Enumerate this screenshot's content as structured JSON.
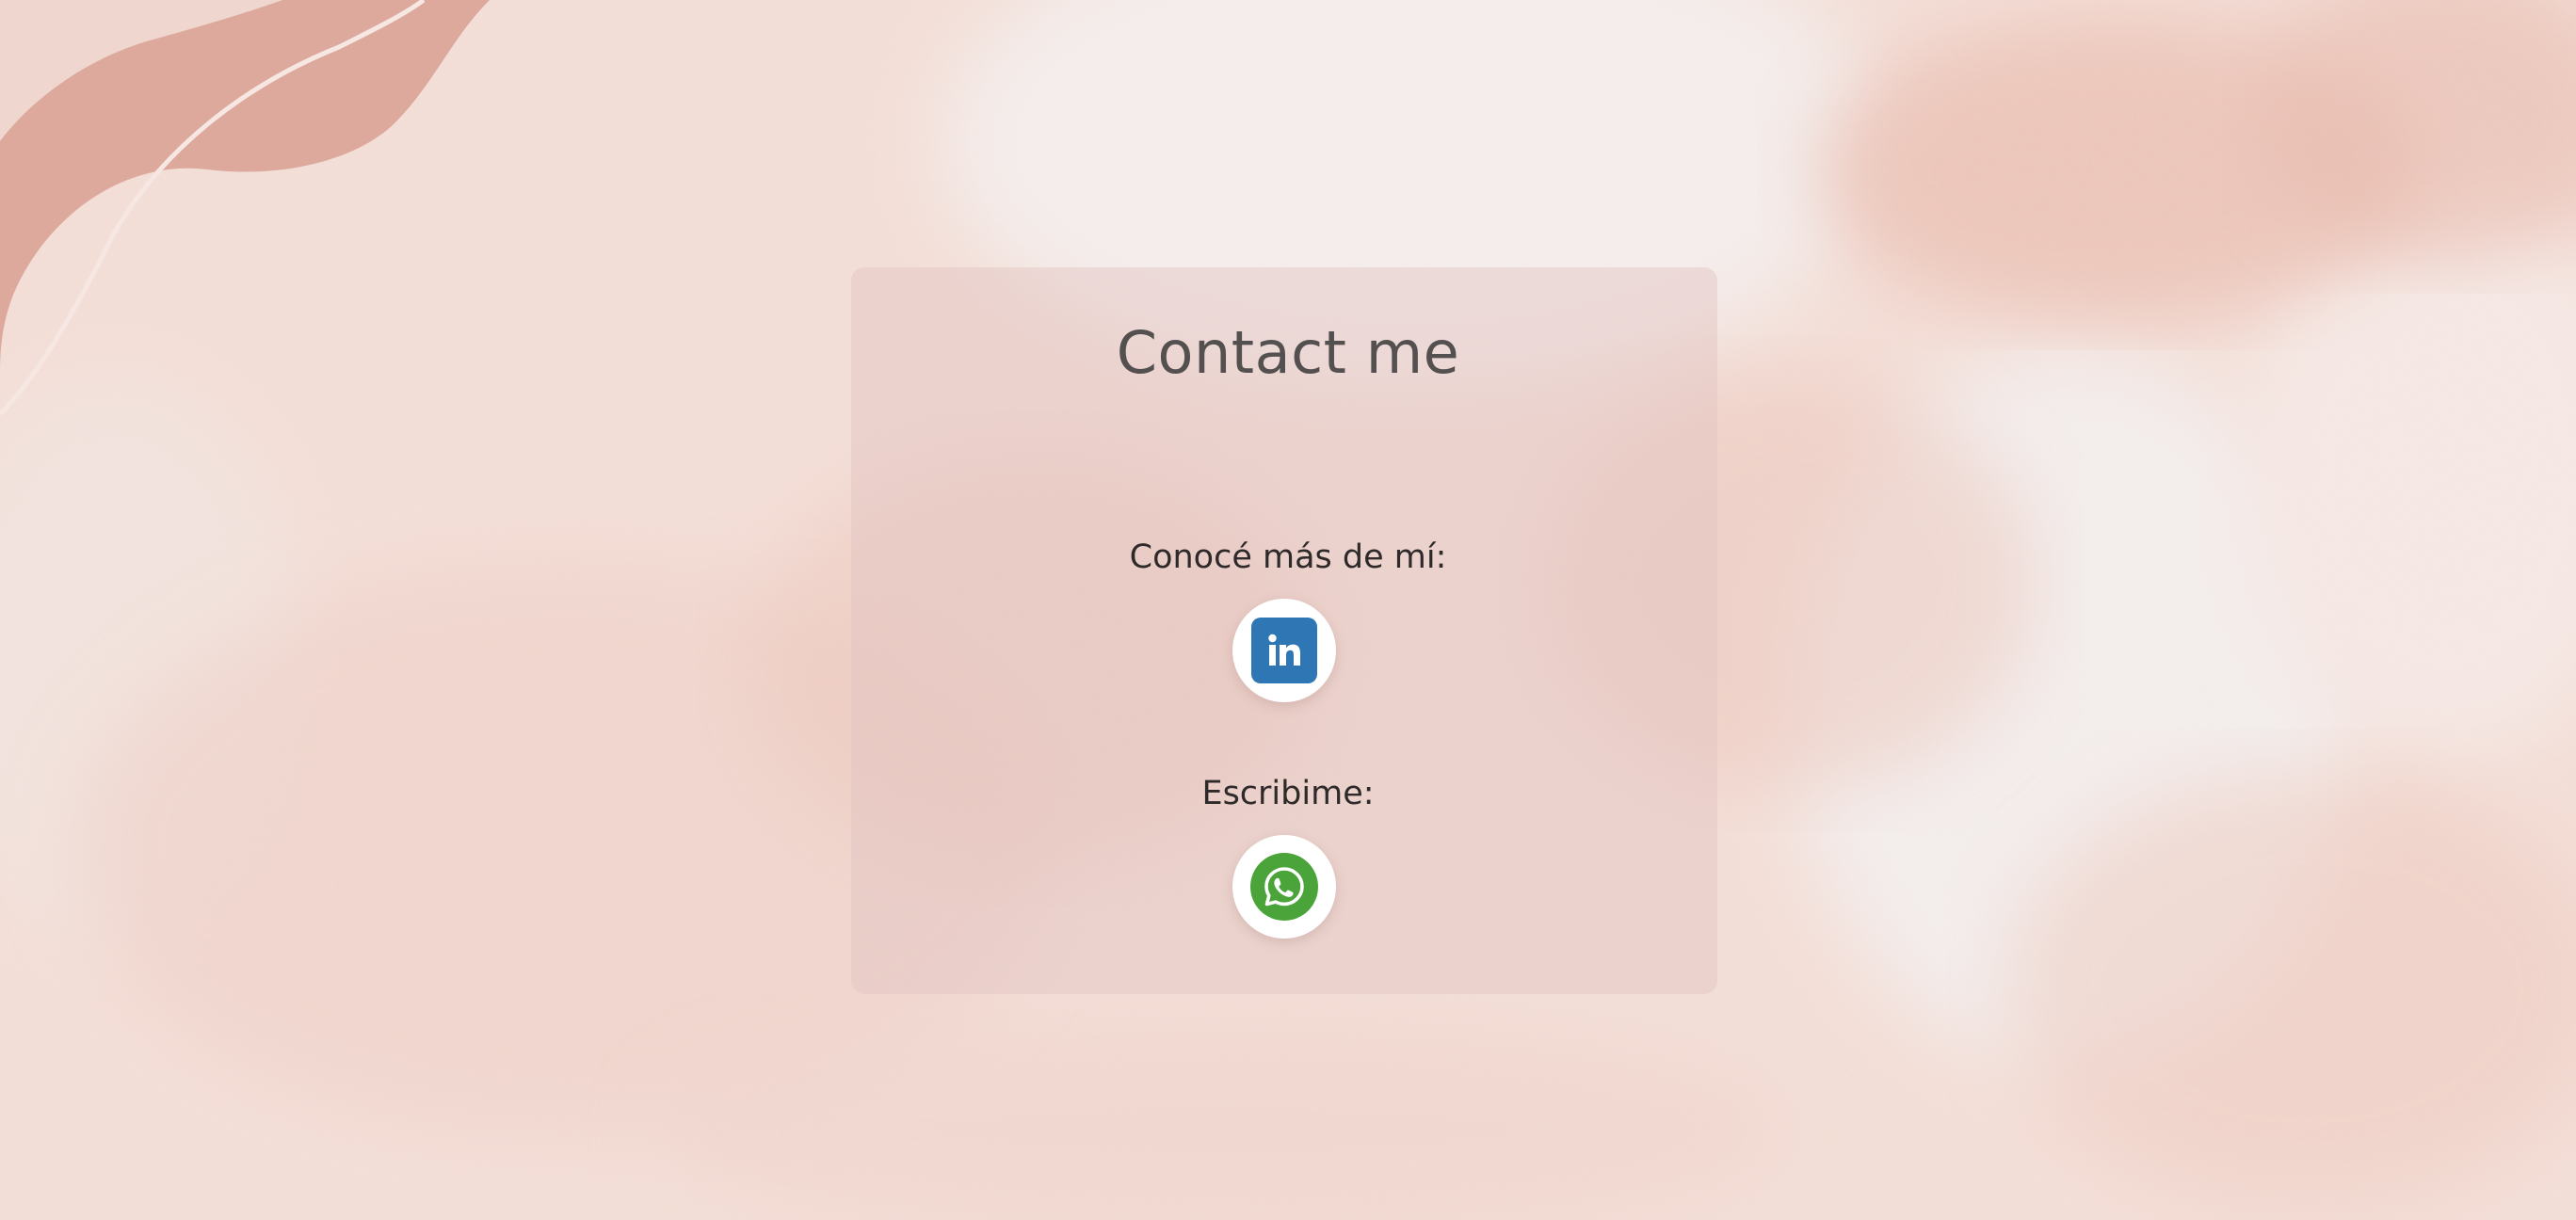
{
  "contact": {
    "title": "Contact me",
    "linkedin_prompt": "Conocé más de mí:",
    "whatsapp_prompt": "Escribime:"
  },
  "icons": {
    "linkedin": "linkedin-icon",
    "whatsapp": "whatsapp-icon"
  },
  "colors": {
    "background": "#f3dcd5",
    "card": "#e2c4c0",
    "title_text": "#555050",
    "linkedin_blue": "#2e77b4",
    "whatsapp_green": "#4aa43a"
  }
}
